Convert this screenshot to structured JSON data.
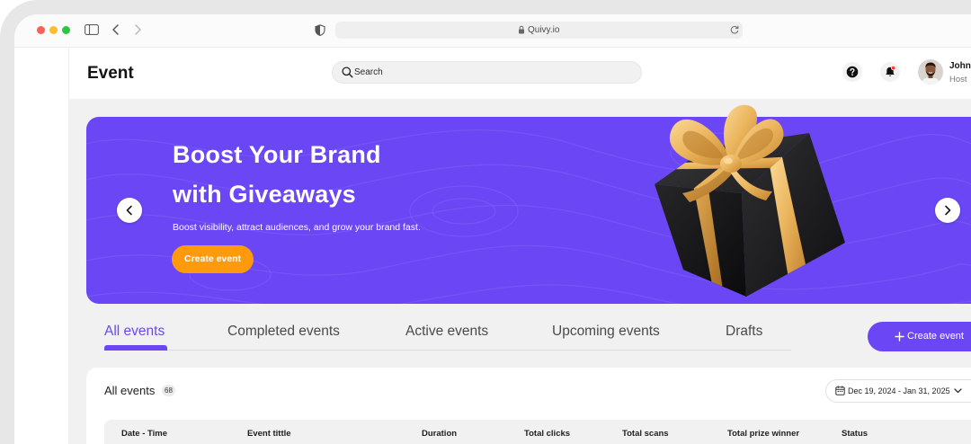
{
  "browser": {
    "url": "Quivy.io",
    "icons": [
      "close-dot-icon",
      "minimize-dot-icon",
      "maximize-dot-icon",
      "sidebar-toggle-icon",
      "back-chevron-icon",
      "forward-chevron-icon",
      "shield-icon",
      "lock-icon",
      "reload-icon"
    ]
  },
  "header": {
    "title": "Event",
    "search_placeholder": "Search",
    "user": {
      "name": "John",
      "role": "Host"
    },
    "icons": [
      "search-icon",
      "help-icon",
      "bell-icon",
      "avatar"
    ]
  },
  "banner": {
    "title_line1": "Boost Your Brand",
    "title_line2": "with Giveaways",
    "subtitle": "Boost visibility, attract audiences, and grow your brand fast.",
    "cta_label": "Create event",
    "image": "gift-box-illustration",
    "nav_icons": [
      "chevron-left-icon",
      "chevron-right-icon"
    ]
  },
  "tabs": [
    {
      "label": "All events",
      "active": true
    },
    {
      "label": "Completed events",
      "active": false
    },
    {
      "label": "Active events",
      "active": false
    },
    {
      "label": "Upcoming events",
      "active": false
    },
    {
      "label": "Drafts",
      "active": false
    }
  ],
  "create_button": {
    "icon": "plus-icon",
    "label": "Create event"
  },
  "events_card": {
    "title": "All events",
    "count": "68",
    "date_range": "Dec 19, 2024 - Jan 31, 2025",
    "date_icons": [
      "calendar-icon",
      "chevron-down-icon"
    ],
    "columns": [
      "Date - Time",
      "Event tittle",
      "Duration",
      "Total clicks",
      "Total scans",
      "Total prize winner",
      "Status"
    ]
  },
  "colors": {
    "accent": "#6b46f5",
    "cta": "#ff9a0d",
    "notification": "#ff3b30",
    "background": "#f1f1f2",
    "traffic_red": "#fe5f57",
    "traffic_yellow": "#febc2e",
    "traffic_green": "#28c840"
  }
}
